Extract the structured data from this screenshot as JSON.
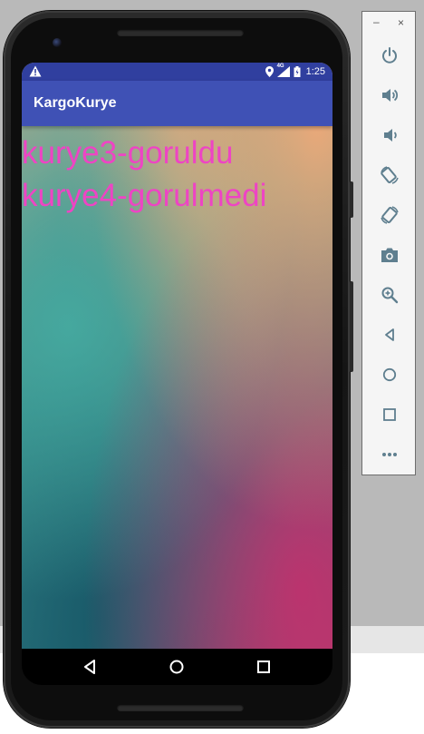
{
  "app": {
    "title": "KargoKurye"
  },
  "status_bar": {
    "time": "1:25",
    "network": "4G",
    "icons": [
      "warning-icon",
      "location-icon",
      "signal-icon",
      "battery-icon"
    ]
  },
  "list": {
    "items": [
      "kurye3-goruldu",
      "kurye4-gorulmedi"
    ]
  },
  "colors": {
    "status_bar": "#303f9f",
    "app_bar": "#3f51b5",
    "list_text": "#ee44c4",
    "panel_icons": "#5f7f8f"
  },
  "nav_bar": {
    "buttons": [
      "back-icon",
      "home-icon",
      "recents-icon"
    ]
  },
  "emulator_panel": {
    "window_buttons": {
      "minimize": "–",
      "close": "×"
    },
    "controls": [
      "power-icon",
      "volume-up-icon",
      "volume-down-icon",
      "rotate-left-icon",
      "rotate-right-icon",
      "camera-icon",
      "zoom-icon",
      "back-icon",
      "home-icon",
      "overview-icon",
      "more-icon"
    ]
  }
}
